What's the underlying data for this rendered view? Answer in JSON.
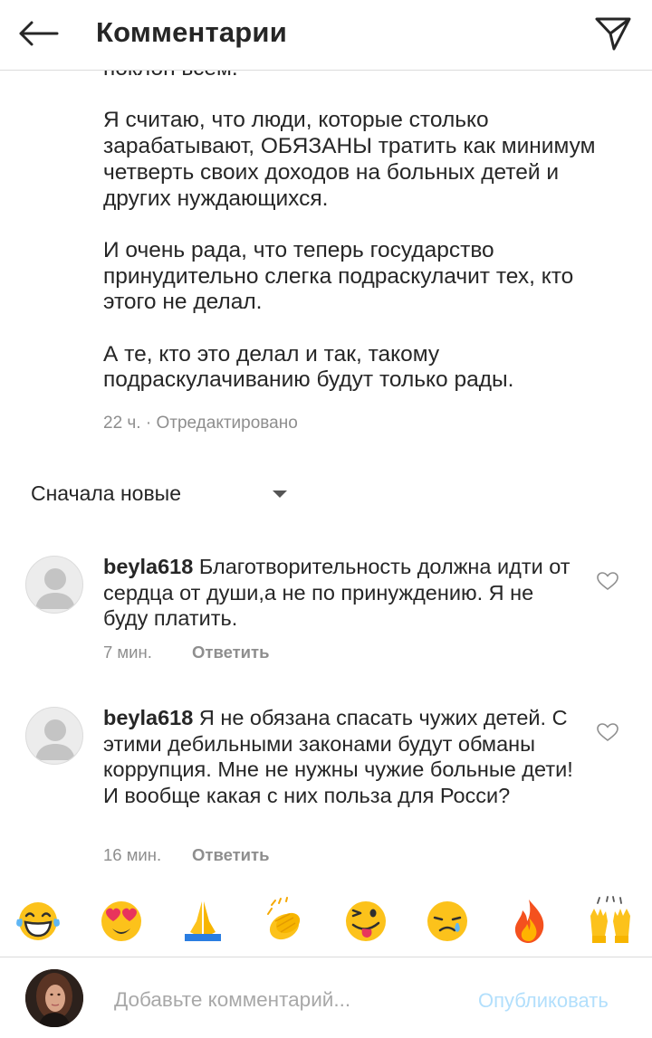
{
  "header": {
    "title": "Комментарии"
  },
  "caption": {
    "text": "поклон всем.\n\nЯ считаю, что люди, которые столько зарабатывают, ОБЯЗАНЫ тратить как минимум четверть своих доходов на больных детей и других нуждающихся.\n\nИ очень рада, что теперь государство принудительно слегка подраскулачит тех, кто этого не делал.\n\nА те, кто это делал и так, такому подраскулачиванию будут только рады.",
    "meta": "22 ч. · Отредактировано"
  },
  "sort": {
    "label": "Сначала новые"
  },
  "comments": [
    {
      "username": "beyla618",
      "text": "Благотворительность должна идти от сердца от души,а не по принуждению. Я не буду платить.",
      "time": "7 мин.",
      "reply_label": "Ответить"
    },
    {
      "username": "beyla618",
      "text": "Я не обязана спасать чужих детей. С этими дебильными законами будут обманы коррупция. Мне не нужны чужие больные дети! И вообще какая с них польза для Росси?",
      "time": "16 мин.",
      "reply_label": "Ответить"
    }
  ],
  "emoji_bar": [
    {
      "name": "tears-of-joy",
      "char": "😂"
    },
    {
      "name": "heart-eyes",
      "char": "😍"
    },
    {
      "name": "folded-hands",
      "char": "🙏"
    },
    {
      "name": "clapping-hands",
      "char": "👏"
    },
    {
      "name": "winking-tongue",
      "char": "😜"
    },
    {
      "name": "sad-face",
      "char": "😢"
    },
    {
      "name": "fire",
      "char": "🔥"
    },
    {
      "name": "raising-hands",
      "char": "🙌"
    }
  ],
  "composer": {
    "placeholder": "Добавьте комментарий...",
    "publish_label": "Опубликовать"
  },
  "colors": {
    "text": "#262626",
    "muted": "#8e8e8e",
    "divider": "#dbdbdb",
    "publish_disabled": "#b2dffc"
  }
}
